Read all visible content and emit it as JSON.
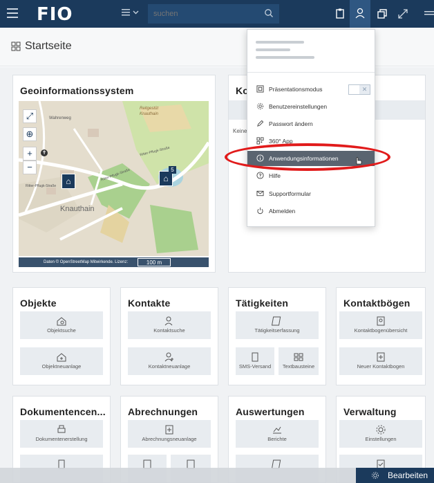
{
  "header": {
    "logo": "FIO",
    "search_placeholder": "suchen"
  },
  "page": {
    "title": "Startseite"
  },
  "map_card": {
    "title": "Geoinformationssystem",
    "map_labels": {
      "reitgestuet": "Reitgestüt",
      "knauthain_small": "Knauthain",
      "knauthain": "Knauthain",
      "wahrenweg": "Wahrenweg",
      "ritter_pflugk_1": "Ritter-Pflugk-Straße",
      "ritter_pflugk_2": "Ritter-Pflugk-Straße",
      "ritter_pflugk_3": "Ritter-Pflugk-Straße",
      "badge": "5",
      "attribution": "Daten © OpenStreetMap Mitwirkende. Lizenz:",
      "scale": "100 m"
    }
  },
  "contact_card": {
    "title_partial": "Ko",
    "body_partial": "Keine"
  },
  "cards": {
    "objekte": {
      "title": "Objekte",
      "tiles": [
        "Objektsuche",
        "Objektneuanlage"
      ]
    },
    "kontakte": {
      "title": "Kontakte",
      "tiles": [
        "Kontaktsuche",
        "Kontaktneuanlage"
      ]
    },
    "taetigkeiten": {
      "title": "Tätigkeiten",
      "tiles": [
        "Tätigkeitserfassung",
        "SMS-Versand",
        "Textbausteine"
      ]
    },
    "kontaktboegen": {
      "title": "Kontaktbögen",
      "tiles": [
        "Kontaktbogenübersicht",
        "Neuer Kontaktbogen"
      ]
    },
    "dokumente": {
      "title": "Dokumentencen...",
      "tiles": [
        "Dokumentenerstellung"
      ]
    },
    "abrechnungen": {
      "title": "Abrechnungen",
      "tiles": [
        "Abrechnungsneuanlage"
      ]
    },
    "auswertungen": {
      "title": "Auswertungen",
      "tiles": [
        "Berichte"
      ]
    },
    "verwaltung": {
      "title": "Verwaltung",
      "tiles": [
        "Einstellungen"
      ]
    }
  },
  "dropdown": {
    "items": [
      "Präsentationsmodus",
      "Benutzereinstellungen",
      "Passwort ändern",
      "360° App",
      "Anwendungsinformationen",
      "Hilfe",
      "Supportformular",
      "Abmelden"
    ],
    "toggle_symbol": "✕"
  },
  "bottom": {
    "edit_label": "Bearbeiten"
  },
  "colors": {
    "navy": "#1b3a5c",
    "highlight": "#5a6470",
    "annotation": "#e11b1b"
  }
}
